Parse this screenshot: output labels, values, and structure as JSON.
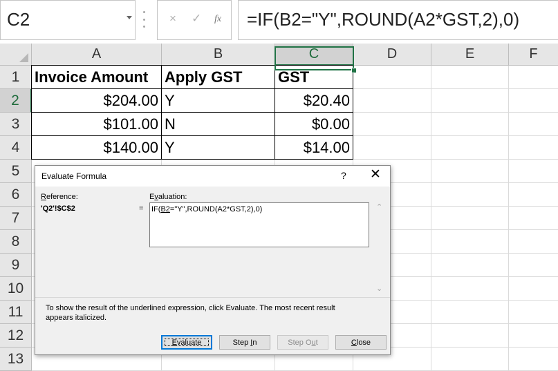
{
  "formula_bar": {
    "name_box": "C2",
    "cancel_icon": "×",
    "enter_icon": "✓",
    "function_icon": "fx",
    "formula": "=IF(B2=\"Y\",ROUND(A2*GST,2),0)"
  },
  "sheet": {
    "columns": [
      "A",
      "B",
      "C",
      "D",
      "E",
      "F"
    ],
    "selected_column": "C",
    "rows": [
      "1",
      "2",
      "3",
      "4",
      "5",
      "6",
      "7",
      "8",
      "9",
      "10",
      "11",
      "12",
      "13"
    ],
    "selected_row": "2",
    "header_row": [
      "Invoice Amount",
      "Apply GST",
      "GST"
    ],
    "data_rows": [
      [
        "$204.00",
        "Y",
        "$20.40"
      ],
      [
        "$101.00",
        "N",
        "$0.00"
      ],
      [
        "$140.00",
        "Y",
        "$14.00"
      ]
    ]
  },
  "dialog": {
    "title": "Evaluate Formula",
    "help_label": "?",
    "close_label": "✕",
    "reference_label_prefix": "",
    "reference_label_ul": "R",
    "reference_label_rest": "eference:",
    "reference_value": "'Q2'!$C$2",
    "equals": "=",
    "evaluation_label_prefix": "E",
    "evaluation_label_ul": "v",
    "evaluation_label_rest": "aluation:",
    "evaluation_pre": "IF(",
    "evaluation_underlined": "B2",
    "evaluation_post": "=\"Y\",ROUND(A2*GST,2),0)",
    "help_text": "To show the result of the underlined expression, click Evaluate.  The most recent result appears italicized.",
    "buttons": {
      "evaluate": {
        "ul": "E",
        "rest": "valuate"
      },
      "step_in": {
        "pre": "Step ",
        "ul": "I",
        "rest": "n"
      },
      "step_out": {
        "pre": "Step O",
        "ul": "u",
        "rest": "t"
      },
      "close": {
        "ul": "C",
        "rest": "lose"
      }
    }
  }
}
